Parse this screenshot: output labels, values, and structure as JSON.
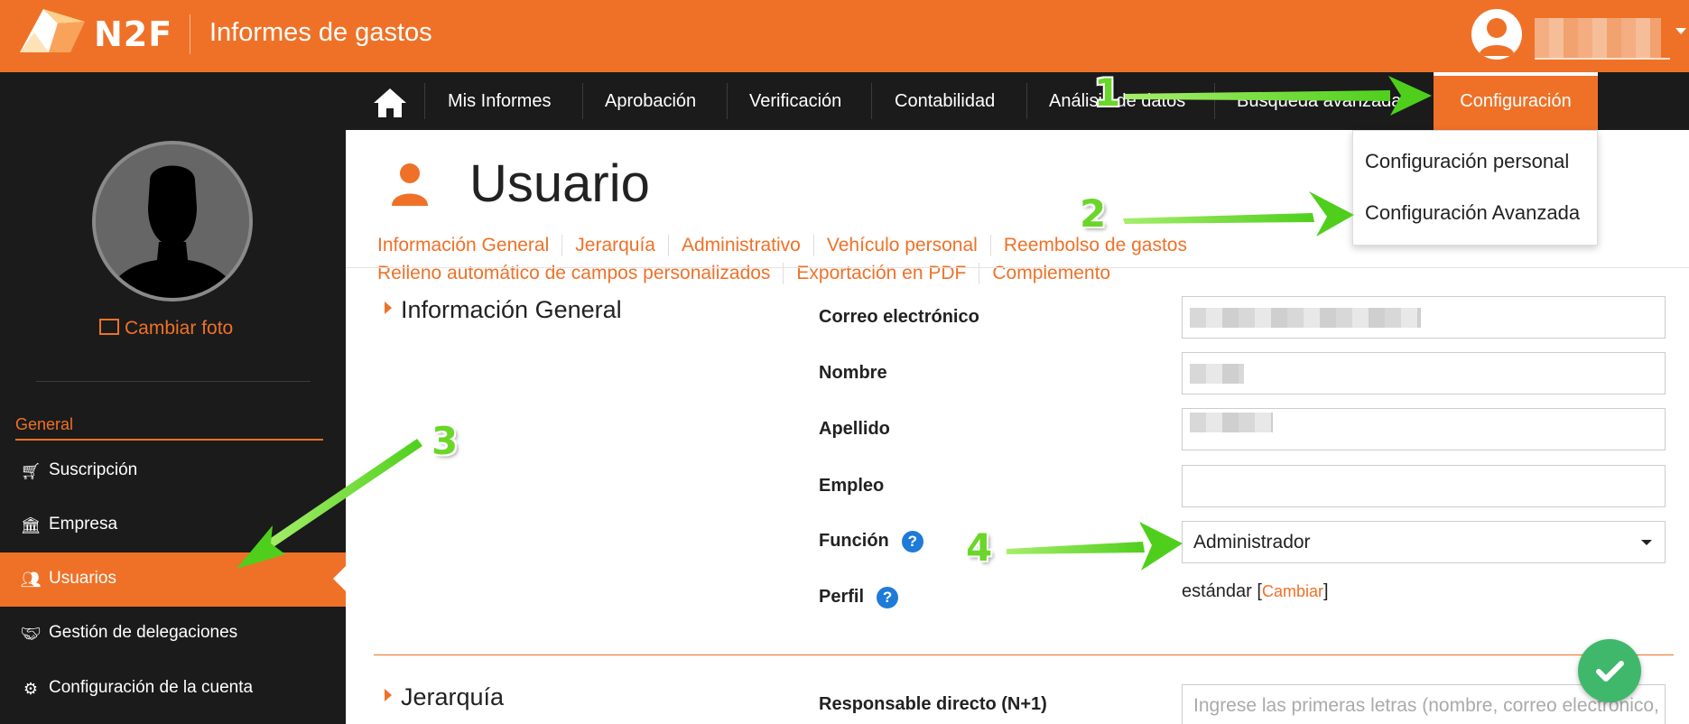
{
  "header": {
    "brand": "N2F",
    "app_title": "Informes de gastos"
  },
  "nav": {
    "items": [
      "Mis Informes",
      "Aprobación",
      "Verificación",
      "Contabilidad",
      "Análisis de datos",
      "Búsqueda avanzada"
    ],
    "active": "Configuración"
  },
  "dropdown": {
    "items": [
      "Configuración personal",
      "Configuración Avanzada"
    ]
  },
  "sidebar": {
    "change_photo": "Cambiar foto",
    "section": "General",
    "items": [
      {
        "label": "Suscripción",
        "icon": "cart-icon"
      },
      {
        "label": "Empresa",
        "icon": "bank-icon"
      },
      {
        "label": "Usuarios",
        "icon": "users-icon",
        "active": true
      },
      {
        "label": "Gestión de delegaciones",
        "icon": "handshake-icon"
      },
      {
        "label": "Configuración de la cuenta",
        "icon": "cogs-icon"
      }
    ]
  },
  "page": {
    "title": "Usuario",
    "tabs_row1": [
      "Información General",
      "Jerarquía",
      "Administrativo",
      "Vehículo personal",
      "Reembolso de gastos"
    ],
    "tabs_row2": [
      "Relleno automático de campos personalizados",
      "Exportación en PDF",
      "Complemento"
    ]
  },
  "form": {
    "section_general": "Información General",
    "labels": {
      "email": "Correo electrónico",
      "first_name": "Nombre",
      "last_name": "Apellido",
      "job": "Empleo",
      "role": "Función",
      "profile": "Perfil"
    },
    "role_value": "Administrador",
    "profile_value": "estándar",
    "profile_change": "Cambiar",
    "section_hierarchy": "Jerarquía",
    "manager_label": "Responsable directo (N+1)",
    "manager_placeholder": "Ingrese las primeras letras (nombre, correo electrónico, e"
  },
  "annotations": {
    "steps": [
      "1",
      "2",
      "3",
      "4"
    ],
    "color": "#6bd62a"
  },
  "colors": {
    "accent": "#ef7127",
    "nav_bg": "#1b1b1b",
    "help": "#1e7bd8",
    "save": "#3fb86b"
  }
}
